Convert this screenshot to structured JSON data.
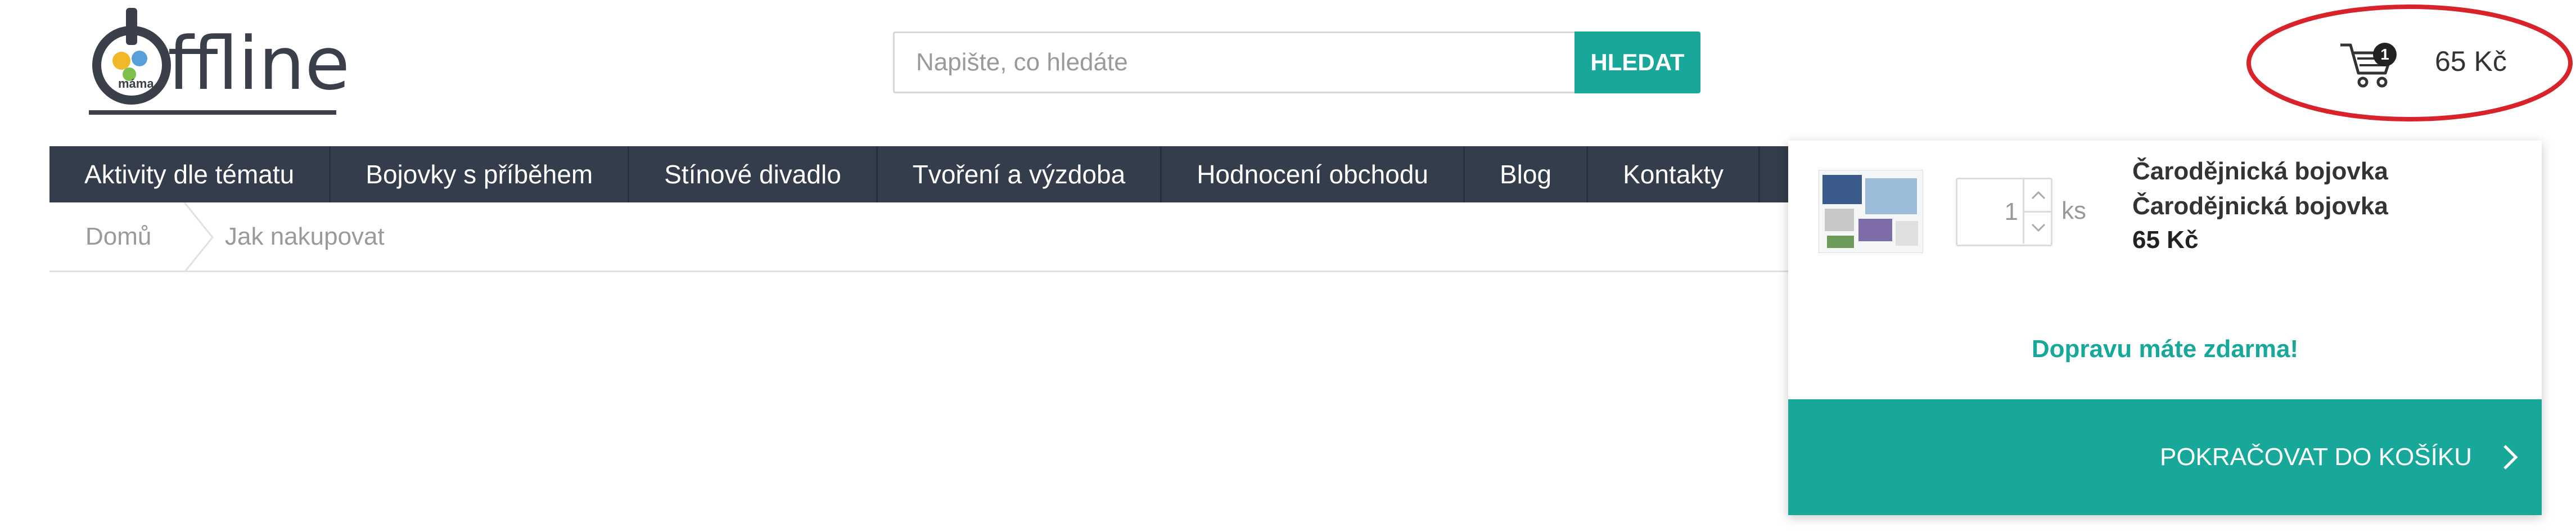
{
  "header": {
    "logo_text": "ffline",
    "logo_small_text": "máma",
    "search": {
      "placeholder": "Napište, co hledáte",
      "button_label": "HLEDAT"
    },
    "cart": {
      "badge_count": "1",
      "total": "65 Kč"
    }
  },
  "nav": {
    "items": [
      {
        "label": "Aktivity dle tématu"
      },
      {
        "label": "Bojovky s příběhem"
      },
      {
        "label": "Stínové divadlo"
      },
      {
        "label": "Tvoření a výzdoba"
      },
      {
        "label": "Hodnocení obchodu"
      },
      {
        "label": "Blog"
      },
      {
        "label": "Kontakty"
      }
    ]
  },
  "breadcrumb": {
    "home": "Domů",
    "current": "Jak nakupovat"
  },
  "cart_dropdown": {
    "item": {
      "quantity": "1",
      "unit": "ks",
      "name_line1": "Čarodějnická bojovka",
      "name_line2": "Čarodějnická bojovka",
      "price": "65 Kč"
    },
    "free_shipping": "Dopravu máte zdarma!",
    "checkout_label": "POKRAČOVAT DO KOŠÍKU"
  },
  "colors": {
    "accent": "#18a89a",
    "nav_bg": "#343d4b",
    "annotation": "#d8232a"
  },
  "icons": [
    "power-icon",
    "cart-icon",
    "chevron-up-icon",
    "chevron-down-icon",
    "chevron-right-icon"
  ]
}
